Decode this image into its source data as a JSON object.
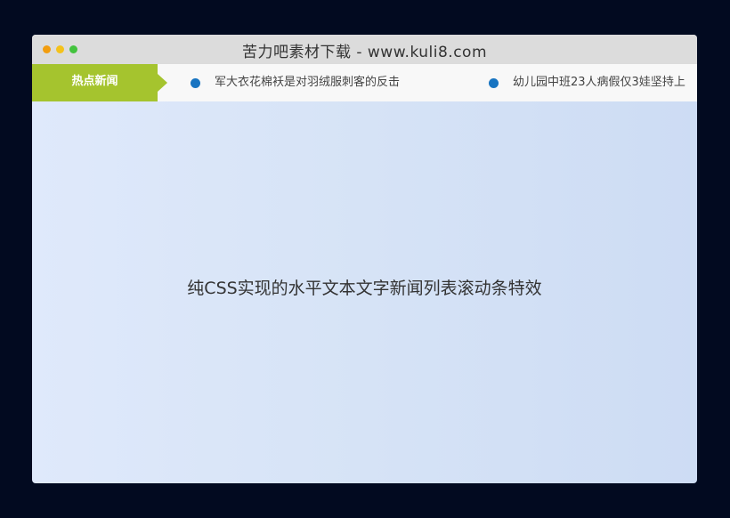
{
  "window": {
    "title": "苦力吧素材下载 - www.kuli8.com"
  },
  "ticker": {
    "label": "热点新闻",
    "items": [
      {
        "text": "军大衣花棉袄是对羽绒服刺客的反击"
      },
      {
        "text": "幼儿园中班23人病假仅3娃坚持上"
      }
    ]
  },
  "main": {
    "caption": "纯CSS实现的水平文本文字新闻列表滚动条特效"
  },
  "colors": {
    "ticker_label_bg": "#a5c42e",
    "bullet": "#1874c1",
    "page_bg": "#020a20"
  }
}
